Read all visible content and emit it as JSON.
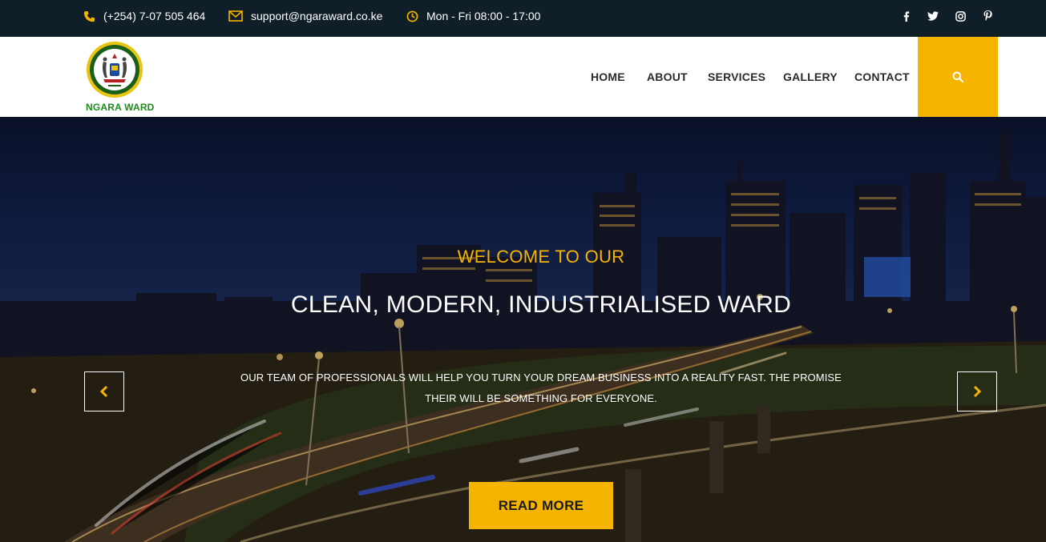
{
  "topbar": {
    "phone": "(+254) 7-07 505 464",
    "email": "support@ngaraward.co.ke",
    "hours": "Mon - Fri 08:00 - 17:00",
    "social": [
      "facebook-icon",
      "twitter-icon",
      "instagram-icon",
      "pinterest-icon"
    ]
  },
  "header": {
    "logo_text": "NGARA WARD",
    "nav": [
      "HOME",
      "ABOUT",
      "SERVICES",
      "GALLERY",
      "CONTACT"
    ]
  },
  "hero": {
    "welcome": "WELCOME TO OUR",
    "headline": "CLEAN, MODERN, INDUSTRIALISED WARD",
    "description_line1": "OUR TEAM OF PROFESSIONALS WILL HELP YOU TURN YOUR DREAM BUSINESS INTO A REALITY FAST. THE PROMISE",
    "description_line2": "THEIR WILL BE SOMETHING FOR EVERYONE.",
    "button": "READ MORE"
  },
  "colors": {
    "accent": "#f5b400",
    "topbar_bg": "#0f1e27",
    "logo_green": "#1d8a1d"
  }
}
